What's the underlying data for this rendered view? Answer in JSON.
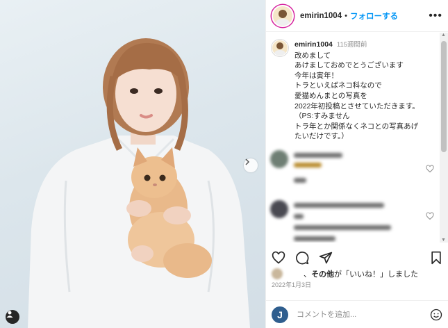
{
  "post": {
    "username": "emirin1004",
    "follow_label": "フォローする",
    "more_label": "•••"
  },
  "caption": {
    "username": "emirin1004",
    "time": "115週間前",
    "lines": [
      "改めまして",
      "あけましておめでとうございます",
      "今年は寅年！",
      "トラといえばネコ科なので",
      "愛猫めんまとの写真を",
      "2022年初投稿とさせていただきます。",
      "（PS:すみません",
      "トラ年とか関係なくネコとの写真あげ",
      "たいだけです。）"
    ]
  },
  "likes": {
    "prefix": "、",
    "others": "その他",
    "suffix": "が「いいね！」しました"
  },
  "date": "2022年1月3日",
  "comment_box": {
    "avatar_letter": "J",
    "placeholder": "コメントを追加..."
  },
  "colors": {
    "follow": "#0095f6",
    "story_ring": "#d6249f",
    "text": "#262626",
    "muted": "#8e8e8e"
  },
  "icons": [
    "chevron-right-icon",
    "tag-person-icon",
    "heart-icon",
    "comment-icon",
    "share-icon",
    "bookmark-icon",
    "emoji-icon",
    "more-icon"
  ]
}
